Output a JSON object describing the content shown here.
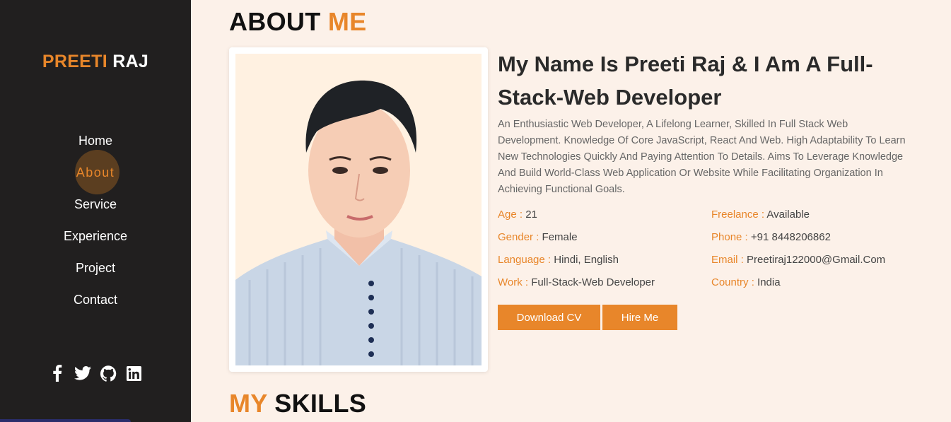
{
  "brand": {
    "first": "PREETI",
    "last": "RAJ"
  },
  "nav": {
    "items": [
      {
        "label": "Home"
      },
      {
        "label": "About"
      },
      {
        "label": "Service"
      },
      {
        "label": "Experience"
      },
      {
        "label": "Project"
      },
      {
        "label": "Contact"
      }
    ],
    "active": "About"
  },
  "socials": [
    "facebook-icon",
    "twitter-icon",
    "github-icon",
    "linkedin-icon"
  ],
  "about": {
    "heading_main": "ABOUT",
    "heading_accent": "ME",
    "title": "My Name Is Preeti Raj & I Am A Full-Stack-Web Developer",
    "description": "An Enthusiastic Web Developer, A Lifelong Learner, Skilled In Full Stack Web Development. Knowledge Of Core JavaScript, React And Web. High Adaptability To Learn New Technologies Quickly And Paying Attention To Details. Aims To Leverage Knowledge And Build World-Class Web Application Or Website While Facilitating Organization In Achieving Functional Goals.",
    "info": [
      {
        "key": "Age :",
        "value": "21"
      },
      {
        "key": "Freelance :",
        "value": "Available"
      },
      {
        "key": "Gender :",
        "value": "Female"
      },
      {
        "key": "Phone :",
        "value": "+91 8448206862"
      },
      {
        "key": "Language :",
        "value": "Hindi, English"
      },
      {
        "key": "Email :",
        "value": "Preetiraj122000@Gmail.Com"
      },
      {
        "key": "Work :",
        "value": "Full-Stack-Web Developer"
      },
      {
        "key": "Country :",
        "value": "India"
      }
    ],
    "download_label": "Download CV",
    "hire_label": "Hire Me"
  },
  "skills": {
    "heading_accent": "MY",
    "heading_main": "SKILLS"
  },
  "colors": {
    "accent": "#e8862a",
    "sidebar": "#211f1f",
    "page": "#fcf1e9"
  }
}
